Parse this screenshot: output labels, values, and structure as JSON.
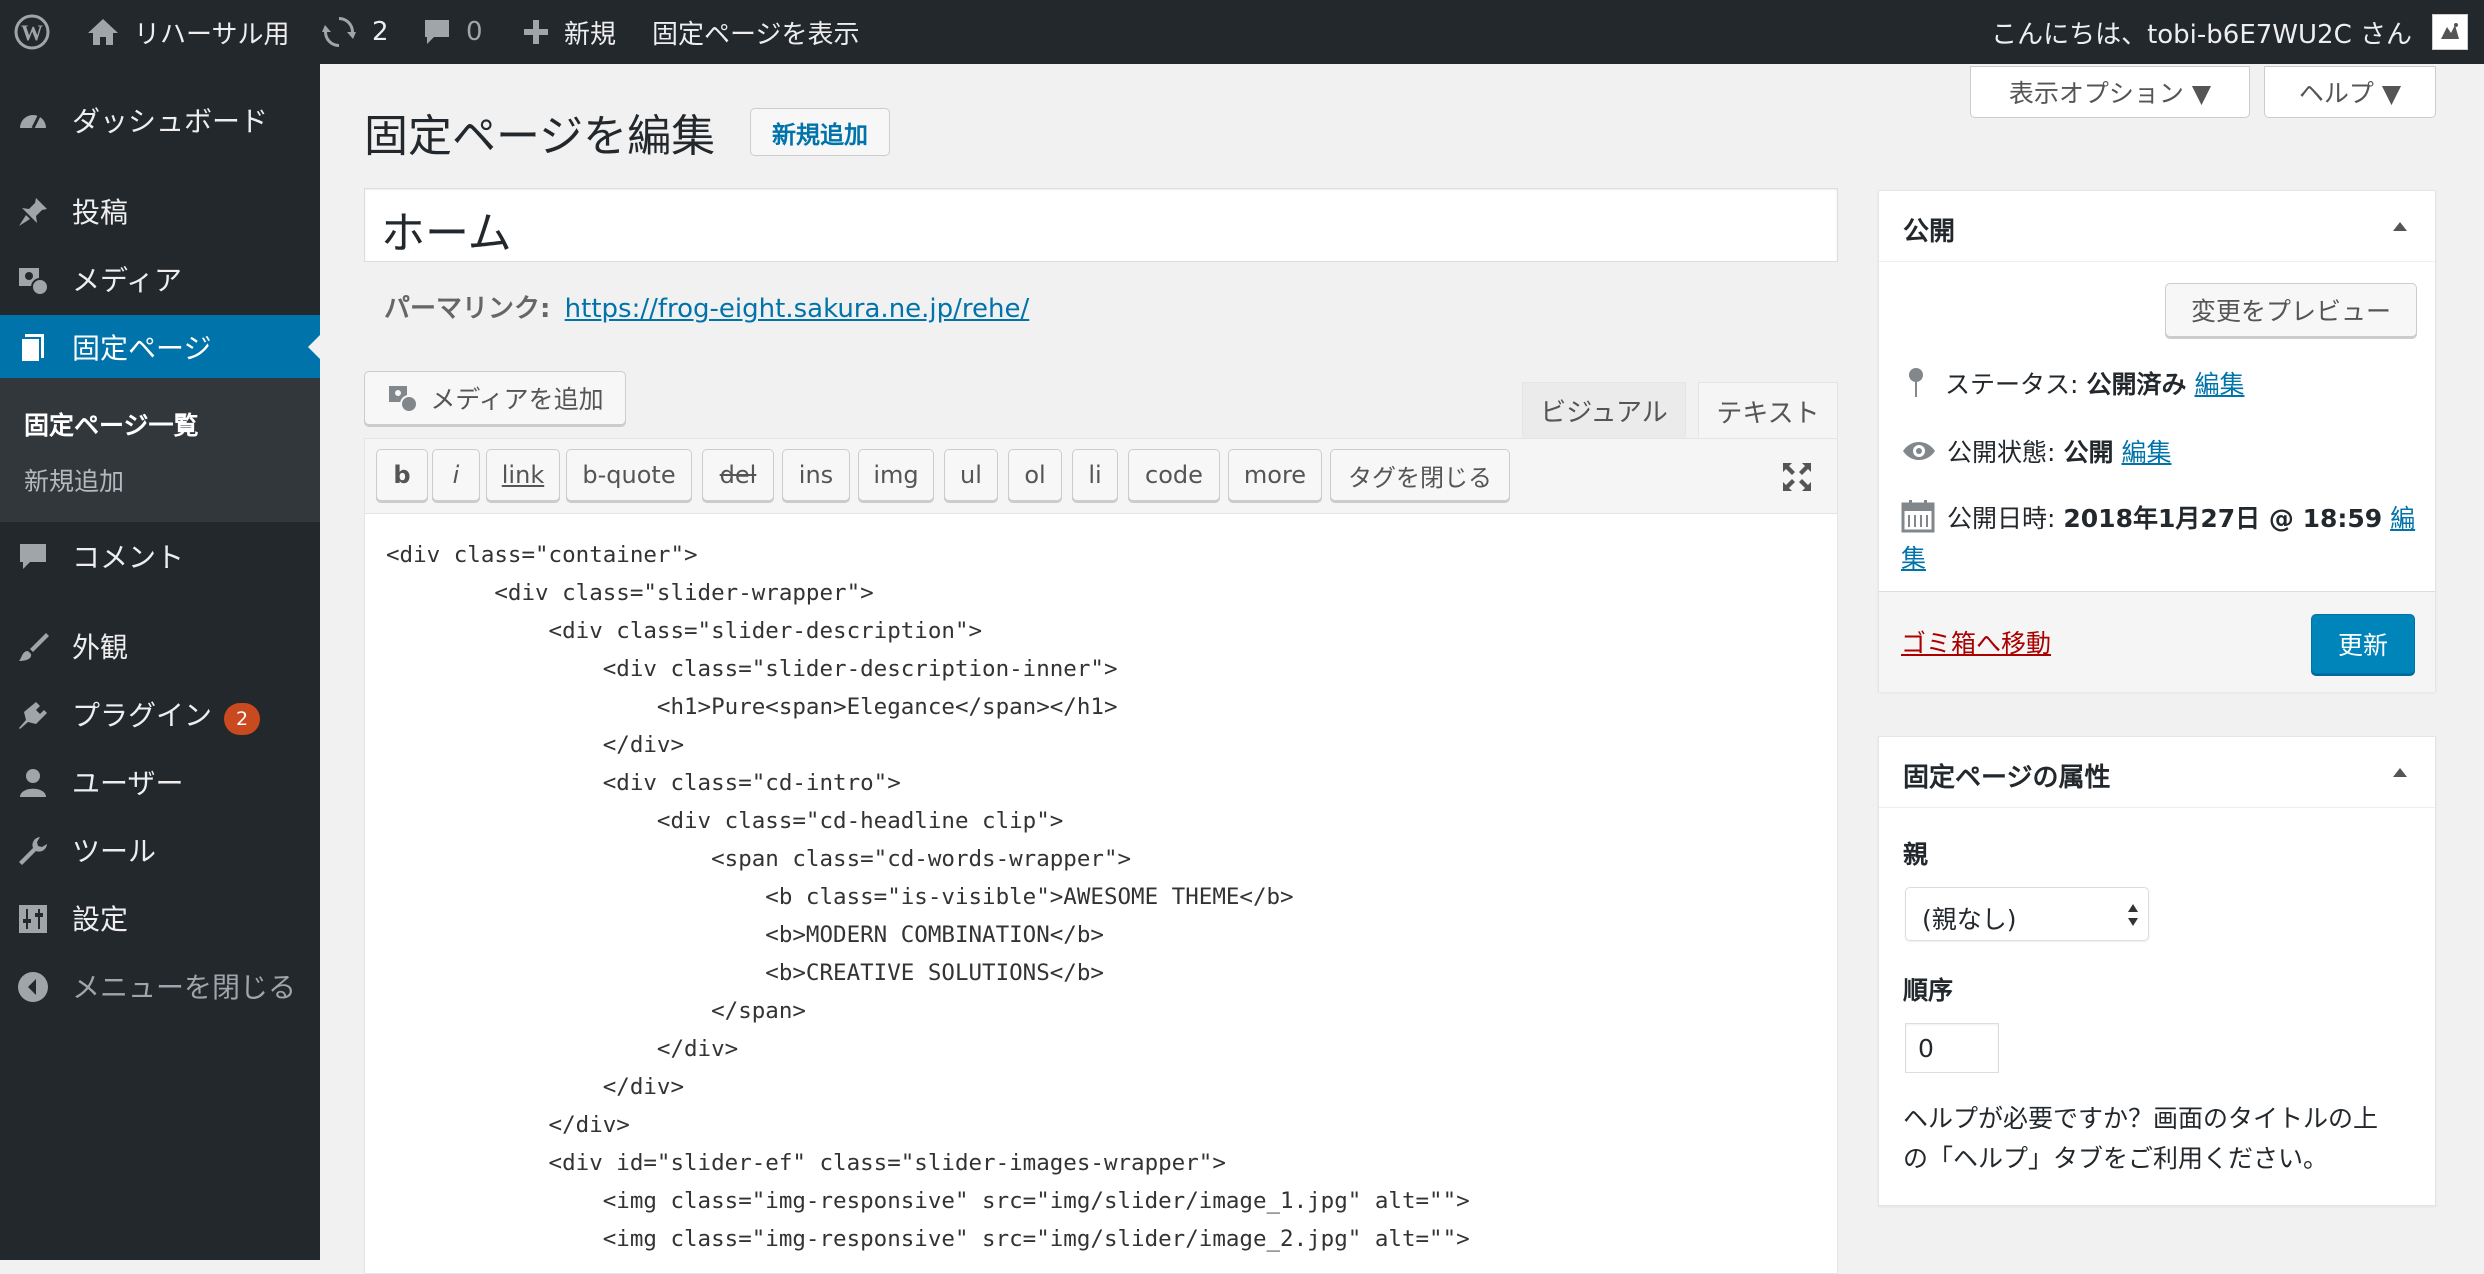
{
  "admin_bar": {
    "site_name": "リハーサル用",
    "updates_count": "2",
    "comments_count": "0",
    "new_label": "新規",
    "view_page_label": "固定ページを表示",
    "greeting": "こんにちは、tobi-b6E7WU2C さん"
  },
  "sidebar": {
    "dashboard": "ダッシュボード",
    "posts": "投稿",
    "media": "メディア",
    "pages": "固定ページ",
    "pages_submenu": [
      "固定ページ一覧",
      "新規追加"
    ],
    "comments": "コメント",
    "appearance": "外観",
    "plugins": "プラグイン",
    "plugins_badge": "2",
    "users": "ユーザー",
    "tools": "ツール",
    "settings": "設定",
    "collapse": "メニューを閉じる"
  },
  "screen_meta": {
    "screen_options": "表示オプション ▼",
    "help": "ヘルプ ▼"
  },
  "page": {
    "heading": "固定ページを編集",
    "add_new": "新規追加",
    "title_value": "ホーム",
    "permalink_label": "パーマリンク:",
    "permalink_url": "https://frog-eight.sakura.ne.jp/rehe/"
  },
  "editor": {
    "add_media": "メディアを追加",
    "tab_visual": "ビジュアル",
    "tab_text": "テキスト",
    "quicktags": [
      "b",
      "i",
      "link",
      "b-quote",
      "del",
      "ins",
      "img",
      "ul",
      "ol",
      "li",
      "code",
      "more",
      "タグを閉じる"
    ],
    "code_lines": [
      "<div class=\"container\">",
      "        <div class=\"slider-wrapper\">",
      "            <div class=\"slider-description\">",
      "                <div class=\"slider-description-inner\">",
      "                    <h1>Pure<span>Elegance</span></h1>",
      "                </div>",
      "                <div class=\"cd-intro\">",
      "                    <div class=\"cd-headline clip\">",
      "                        <span class=\"cd-words-wrapper\">",
      "                            <b class=\"is-visible\">AWESOME THEME</b>",
      "                            <b>MODERN COMBINATION</b>",
      "                            <b>CREATIVE SOLUTIONS</b>",
      "                        </span>",
      "                    </div>",
      "                </div>",
      "            </div>",
      "            <div id=\"slider-ef\" class=\"slider-images-wrapper\">",
      "                <img class=\"img-responsive\" src=\"img/slider/image_1.jpg\" alt=\"\">",
      "                <img class=\"img-responsive\" src=\"img/slider/image_2.jpg\" alt=\"\">"
    ]
  },
  "publish_box": {
    "title": "公開",
    "preview_button": "変更をプレビュー",
    "status_label": "ステータス:",
    "status_value": "公開済み",
    "visibility_label": "公開状態:",
    "visibility_value": "公開",
    "date_label": "公開日時:",
    "date_value": "2018年1月27日 @ 18:59",
    "edit_link": "編集",
    "trash_link": "ゴミ箱へ移動",
    "update_button": "更新"
  },
  "attributes_box": {
    "title": "固定ページの属性",
    "parent_label": "親",
    "parent_value": "(親なし)",
    "order_label": "順序",
    "order_value": "0",
    "help_text": [
      "ヘルプが必要ですか？画面のタイトルの上",
      "の「ヘルプ」タブをご利用ください。"
    ]
  }
}
